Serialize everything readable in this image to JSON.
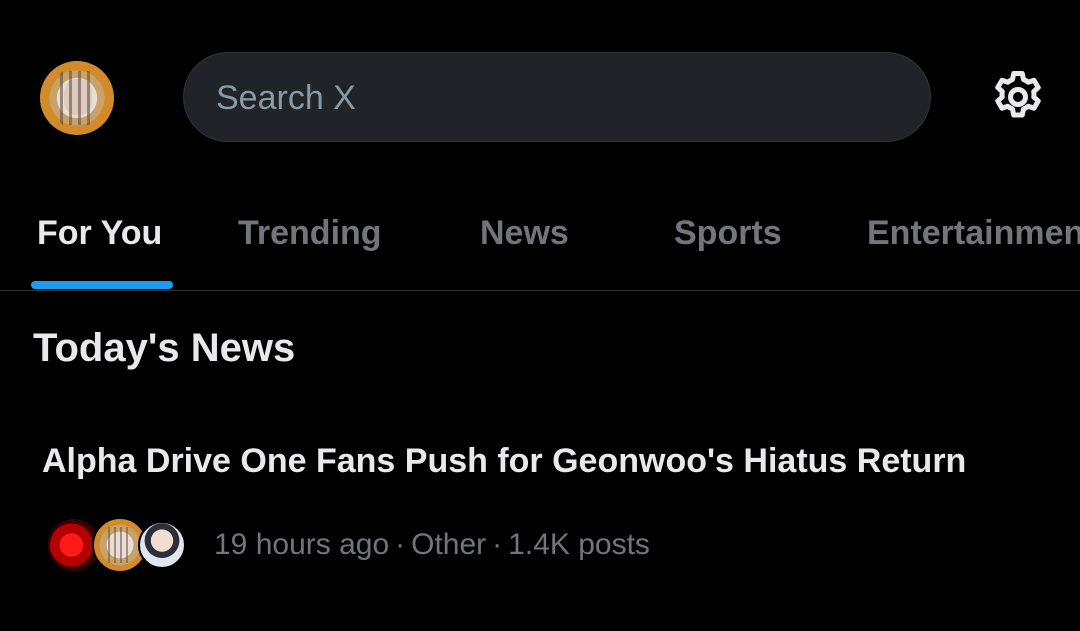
{
  "header": {
    "search": {
      "placeholder": "Search X"
    },
    "icons": {
      "avatar": "profile-avatar",
      "settings": "gear-icon"
    }
  },
  "tabs": [
    {
      "label": "For You",
      "active": true
    },
    {
      "label": "Trending",
      "active": false
    },
    {
      "label": "News",
      "active": false
    },
    {
      "label": "Sports",
      "active": false
    },
    {
      "label": "Entertainment",
      "active": false
    }
  ],
  "section": {
    "title": "Today's News"
  },
  "news_items": [
    {
      "headline": "Alpha Drive One Fans Push for Geonwoo's Hiatus Return",
      "time": "19 hours ago",
      "category": "Other",
      "posts": "1.4K posts"
    }
  ],
  "colors": {
    "background": "#000000",
    "accent": "#1d9bf0",
    "text_primary": "#e7e9ea",
    "text_secondary": "#71767b",
    "search_bg": "#202327"
  }
}
